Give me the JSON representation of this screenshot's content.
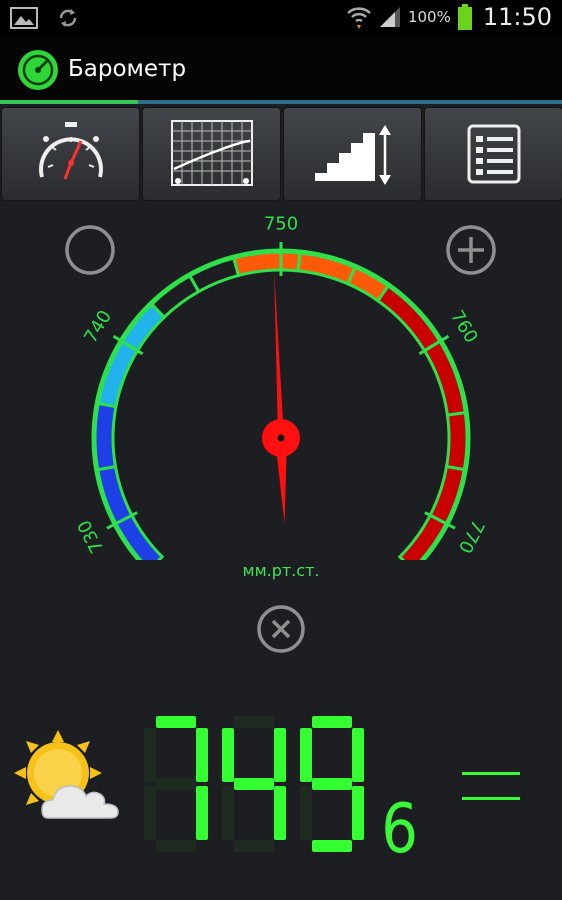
{
  "status_bar": {
    "battery_percent": "100%",
    "time": "11:50"
  },
  "app": {
    "title": "Барометр"
  },
  "toolbar": {
    "tabs": [
      {
        "icon": "barometer-dial-icon"
      },
      {
        "icon": "pressure-graph-icon"
      },
      {
        "icon": "altitude-stairs-icon"
      },
      {
        "icon": "list-icon"
      }
    ]
  },
  "gauge": {
    "min": 727,
    "max": 773,
    "labels": [
      "730",
      "740",
      "750",
      "760",
      "770"
    ],
    "label_values": [
      730,
      740,
      750,
      760,
      770
    ],
    "needle_value": 749.6,
    "unit": "мм.рт.ст.",
    "zone_colors": {
      "blue": "#1e3ee6",
      "light_blue": "#22b3ec",
      "orange": "#ff5a0a",
      "red": "#c80000",
      "green": "#2ee04a"
    }
  },
  "reading": {
    "digits": "749",
    "suffix": "6"
  },
  "colors": {
    "lcd_on": "#33ff33",
    "lcd_off": "#1f2a21",
    "accent": "#37c55a"
  },
  "icons": {
    "status": [
      "gallery-icon",
      "sync-icon",
      "wifi-icon",
      "signal-icon",
      "battery-icon"
    ],
    "gauge_controls": [
      "empty-circle-icon",
      "plus-icon",
      "close-icon"
    ],
    "weather": "partly-cloudy-icon",
    "trend": "equals-trend-icon"
  }
}
